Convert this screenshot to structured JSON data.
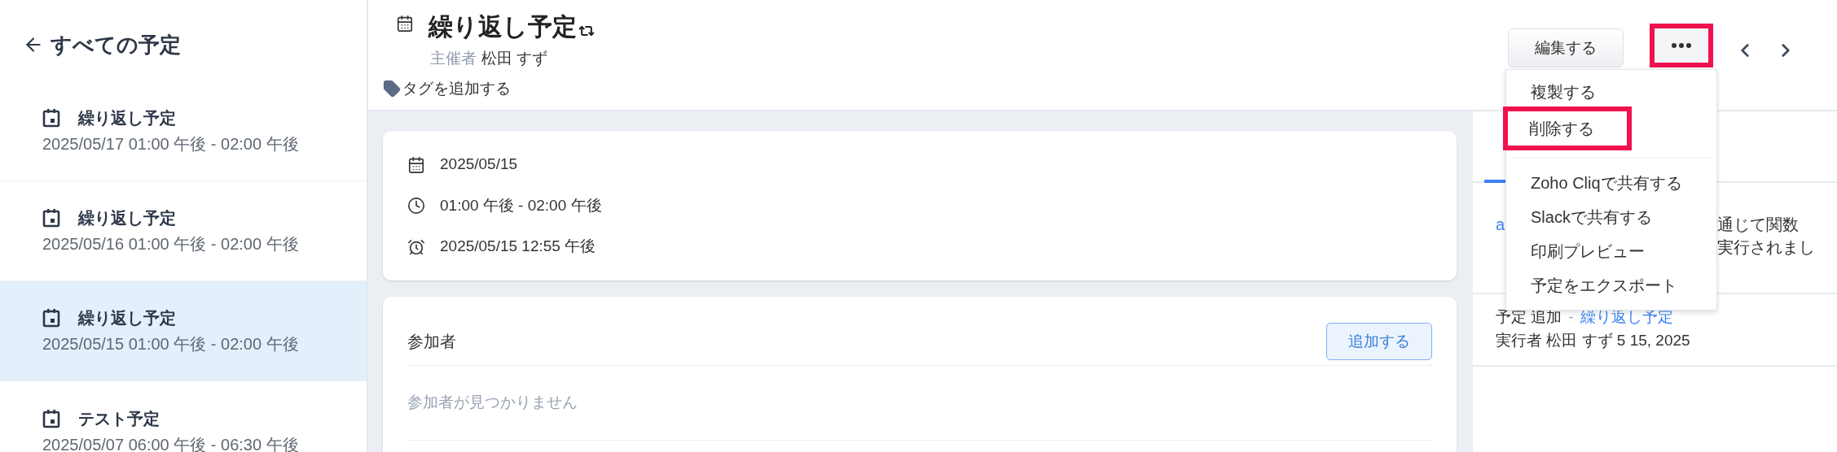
{
  "sidebar": {
    "back_label": "すべての予定",
    "items": [
      {
        "title": "繰り返し予定",
        "time": "2025/05/17 01:00 午後 - 02:00 午後",
        "selected": false
      },
      {
        "title": "繰り返し予定",
        "time": "2025/05/16 01:00 午後 - 02:00 午後",
        "selected": false
      },
      {
        "title": "繰り返し予定",
        "time": "2025/05/15 01:00 午後 - 02:00 午後",
        "selected": true
      },
      {
        "title": "テスト予定",
        "time": "2025/05/07 06:00 午後 - 06:30 午後",
        "selected": false
      }
    ]
  },
  "header": {
    "title": "繰り返し予定",
    "recurring": true,
    "organizer_label": "主催者",
    "organizer": "松田 すず",
    "add_tag": "タグを追加する",
    "edit_button": "編集する",
    "more_button": {
      "highlighted": true
    }
  },
  "details": [
    {
      "kind": "date",
      "text": "2025/05/15"
    },
    {
      "kind": "time",
      "text": "01:00 午後 - 02:00 午後"
    },
    {
      "kind": "reminder",
      "text": "2025/05/15 12:55 午後"
    }
  ],
  "participants": {
    "title": "参加者",
    "add_button": "追加する",
    "empty_text": "参加者が見つかりません"
  },
  "activity_panel": {
    "tab": {
      "selected": true
    },
    "first_entry_lines": [
      {
        "left": "a",
        "left_link": true,
        "right": "通じて関数"
      },
      {
        "right": "実行されまし"
      }
    ],
    "second_entry": {
      "action": "予定 追加",
      "separator": "-",
      "link": "繰り返し予定",
      "by": "実行者 松田 すず 5 15, 2025"
    }
  },
  "menu": {
    "items": [
      {
        "label": "複製する",
        "highlighted": false,
        "divider_before": false
      },
      {
        "label": "削除する",
        "highlighted": true,
        "divider_before": false
      },
      {
        "label": "Zoho Cliqで共有する",
        "highlighted": false,
        "divider_before": true
      },
      {
        "label": "Slackで共有する",
        "highlighted": false,
        "divider_before": false
      },
      {
        "label": "印刷プレビュー",
        "highlighted": false,
        "divider_before": false
      },
      {
        "label": "予定をエクスポート",
        "highlighted": false,
        "divider_before": false
      }
    ]
  }
}
